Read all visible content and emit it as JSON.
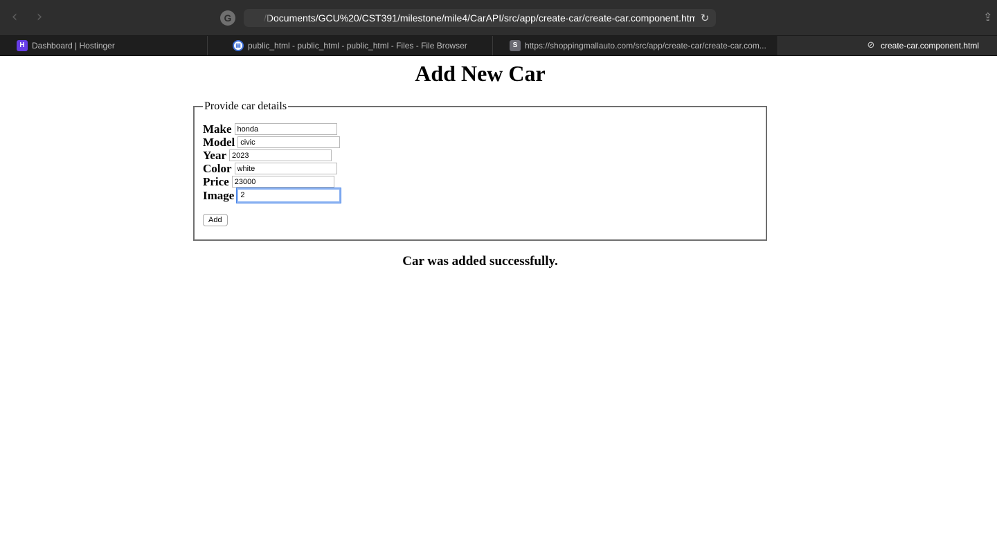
{
  "browser": {
    "url": "s/Documents/GCU%20/CST391/milestone/mile4/CarAPI/src/app/create-car/create-car.component.html",
    "tabs": [
      {
        "label": "Dashboard | Hostinger",
        "icon": "hostinger-icon"
      },
      {
        "label": "public_html - public_html - public_html - Files - File Browser",
        "icon": "file-browser-icon"
      },
      {
        "label": "https://shoppingmallauto.com/src/app/create-car/create-car.com...",
        "icon": "site-s-icon"
      },
      {
        "label": "create-car.component.html",
        "icon": "compass-icon",
        "active": true
      }
    ]
  },
  "page": {
    "title": "Add New Car",
    "fieldset_legend": "Provide car details",
    "fields": [
      {
        "label": "Make",
        "value": "honda"
      },
      {
        "label": "Model",
        "value": "civic"
      },
      {
        "label": "Year",
        "value": "2023"
      },
      {
        "label": "Color",
        "value": "white"
      },
      {
        "label": "Price",
        "value": "23000"
      },
      {
        "label": "Image",
        "value": "2",
        "focused": true
      }
    ],
    "add_button_label": "Add",
    "success_message": "Car was added successfully."
  },
  "colors": {
    "chrome_bg": "#2e2e2e",
    "tabbar_bg": "#1e1e1e",
    "focus_ring": "#4a86e8"
  }
}
